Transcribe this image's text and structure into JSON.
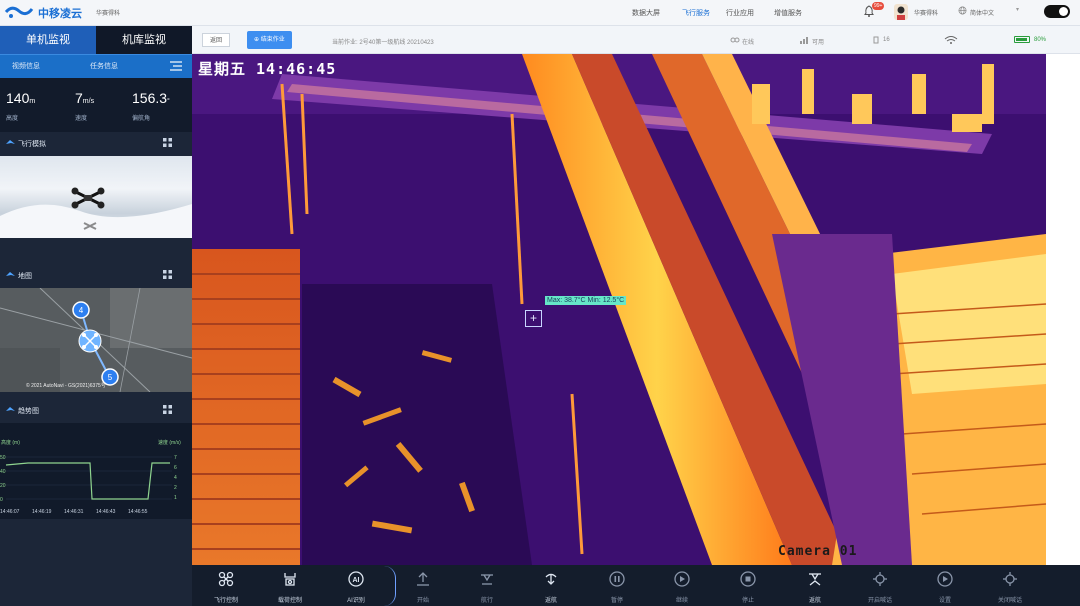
{
  "topnav": {
    "brand": "中移凌云",
    "brand_sub": "华赛得科",
    "items": [
      "数据大屏",
      "飞行服务",
      "行业应用",
      "增值服务"
    ],
    "active_index": 1,
    "badge": "99+",
    "username": "华赛得科",
    "language": "简体中文"
  },
  "sidebar": {
    "tabs": [
      "单机监视",
      "机库监视"
    ],
    "active_tab": 0,
    "info_tabs": [
      "视频信息",
      "任务信息"
    ],
    "stats": [
      {
        "value": "140",
        "unit": "m",
        "label": "高度"
      },
      {
        "value": "7",
        "unit": "m/s",
        "label": "速度"
      },
      {
        "value": "156.3",
        "unit": "°",
        "label": "偏航角"
      }
    ],
    "sections": [
      "飞行模拟",
      "地图",
      "趋势图"
    ],
    "map": {
      "attribution": "© 2021 AutoNavi - GS(2021)6375号",
      "waypoints": [
        "4",
        "5"
      ]
    },
    "trend": {
      "left_label": "高度 (m)",
      "right_label": "速度 (m/s)",
      "times": [
        "14:46:07",
        "14:46:19",
        "14:46:31",
        "14:46:43",
        "14:46:55"
      ]
    }
  },
  "statusbar": {
    "back_label": "返回",
    "task_label": "结束作业",
    "task_name": "当前作业: 2号40第一级航线 20210423",
    "items": [
      "在线",
      "可用",
      "16"
    ],
    "battery_pct": 0.8,
    "battery_label": "80%"
  },
  "video": {
    "overlay_date": "星期五 14:46:45",
    "camera_label": "Camera 01",
    "temp_readout": "Max: 38.7°C  Min: 12.5°C"
  },
  "controls": [
    {
      "label": "飞行控制",
      "icon": "drone-icon"
    },
    {
      "label": "载荷控制",
      "icon": "gimbal-icon"
    },
    {
      "label": "AI识别",
      "icon": "ai-icon"
    },
    {
      "label": "开始",
      "icon": "takeoff-icon"
    },
    {
      "label": "航行",
      "icon": "fly-icon"
    },
    {
      "label": "返航",
      "icon": "return-icon"
    },
    {
      "label": "暂停",
      "icon": "pause-icon"
    },
    {
      "label": "继续",
      "icon": "play-icon"
    },
    {
      "label": "停止",
      "icon": "stop-icon"
    },
    {
      "label": "返航",
      "icon": "home-icon"
    },
    {
      "label": "开启喊话",
      "icon": "speaker-on-icon"
    },
    {
      "label": "设置",
      "icon": "settings-icon"
    },
    {
      "label": "关闭喊话",
      "icon": "speaker-off-icon"
    }
  ],
  "colors": {
    "accent": "#1f5fb8",
    "info_bar": "#1b6fc8",
    "task_button": "#3d8ef0",
    "temp_box": "#66e6c8",
    "trend_line": "#8fd48f"
  }
}
